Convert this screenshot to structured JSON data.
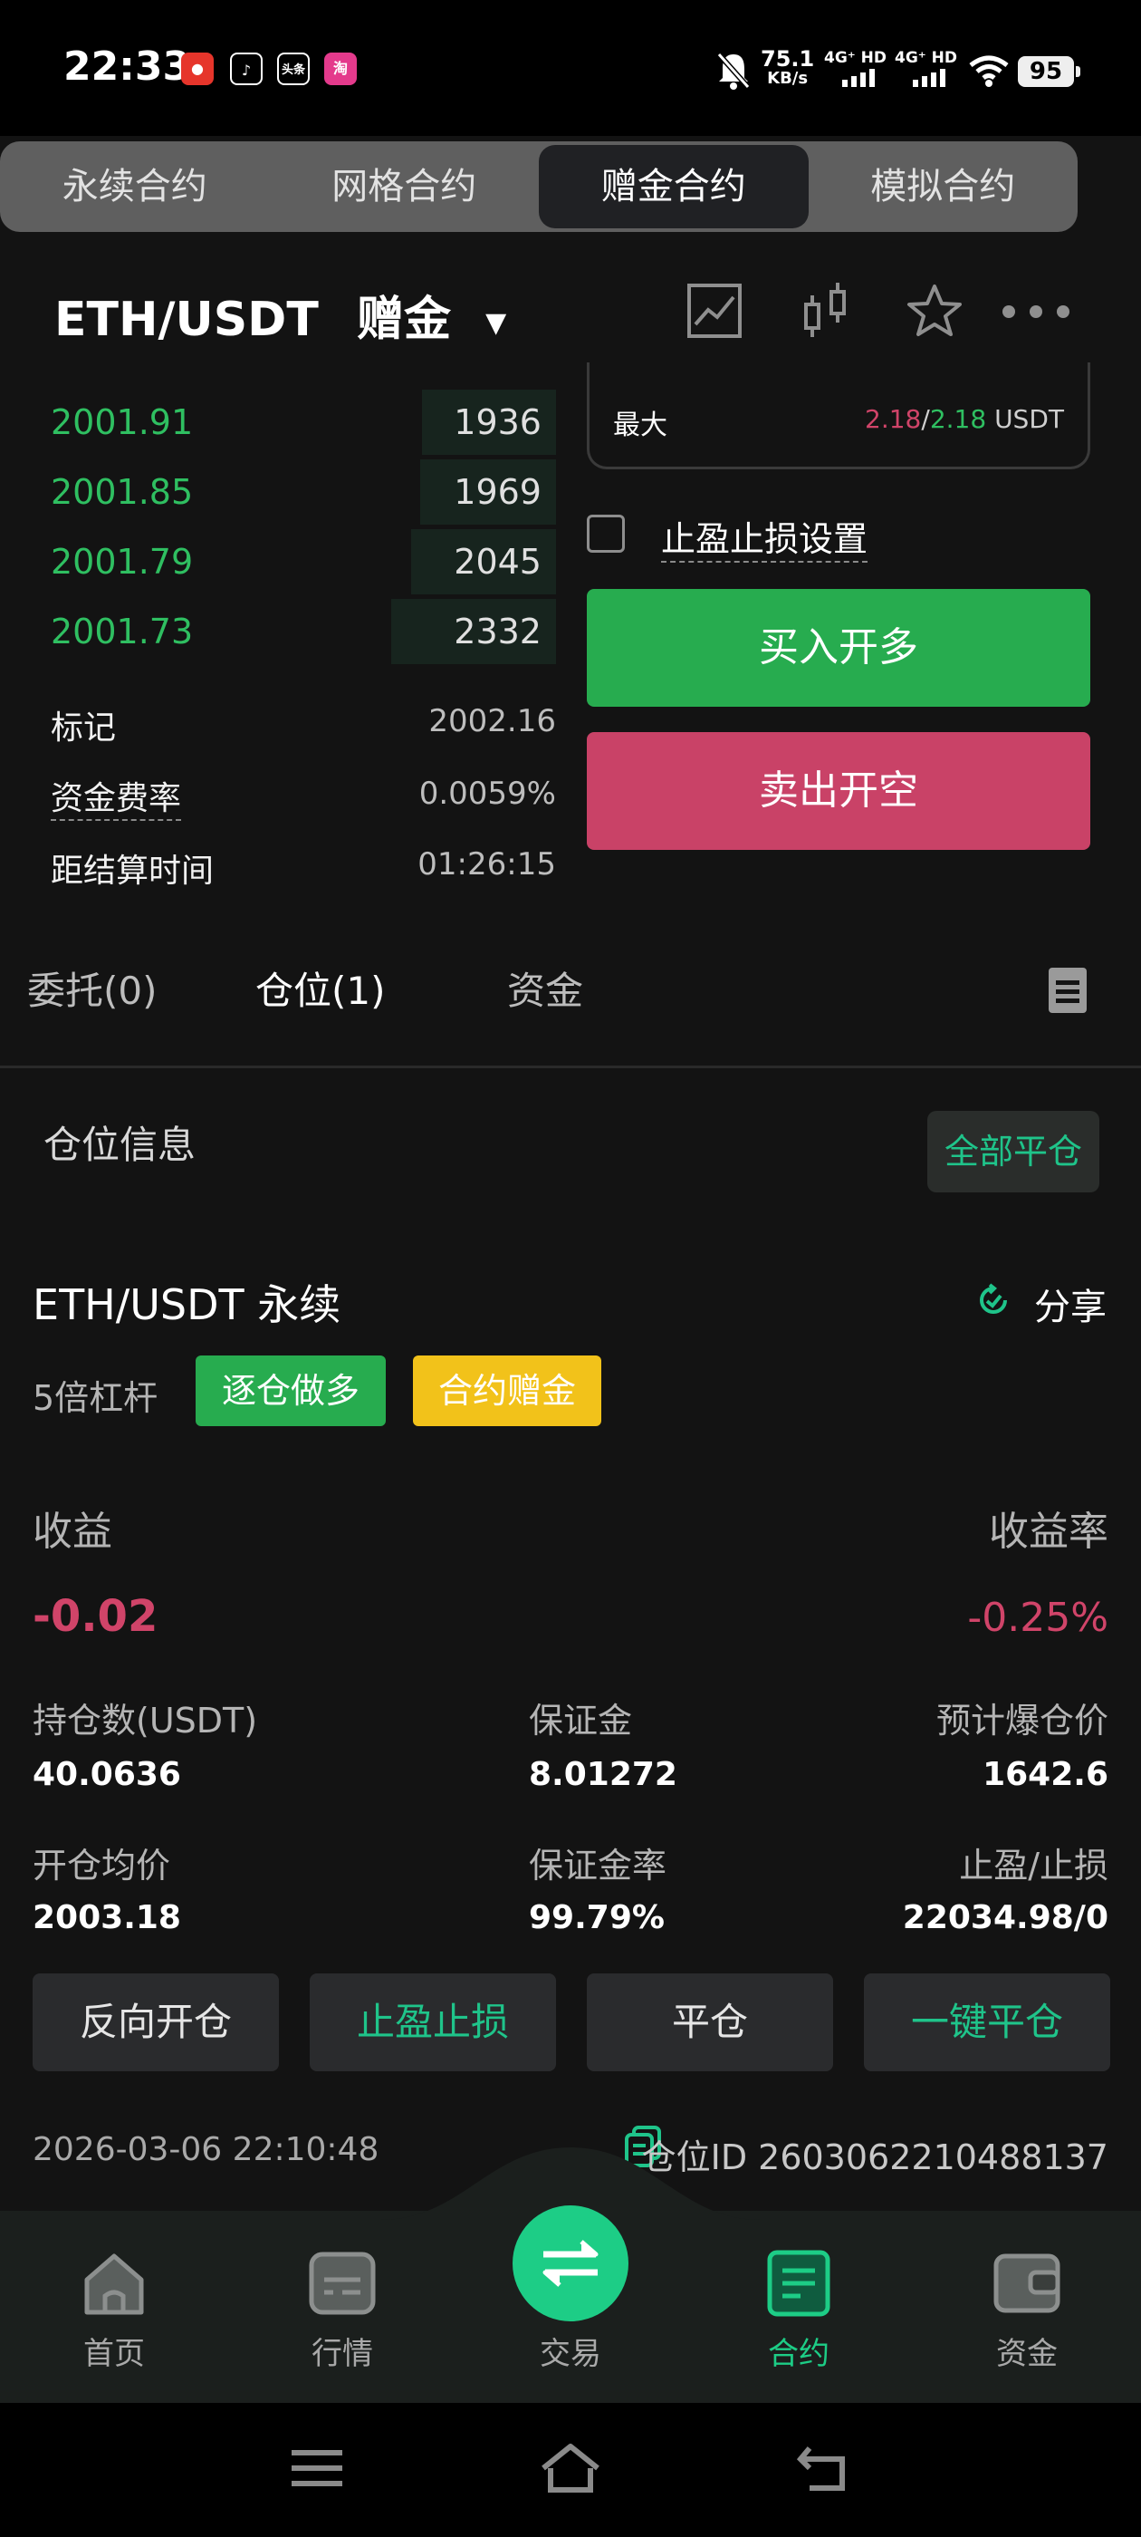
{
  "status_bar": {
    "time": "22:33",
    "app_icons": [
      "app-icon-1",
      "app-icon-2",
      "头条",
      "淘"
    ],
    "net_speed_value": "75.1",
    "net_speed_unit": "KB/s",
    "signal1_label": "4G⁺ HD",
    "signal2_label": "4G⁺ HD",
    "battery": "95"
  },
  "top_tabs": [
    {
      "label": "永续合约",
      "active": false
    },
    {
      "label": "网格合约",
      "active": false
    },
    {
      "label": "赠金合约",
      "active": true
    },
    {
      "label": "模拟合约",
      "active": false
    }
  ],
  "header": {
    "pair": "ETH/USDT",
    "mode": "赠金",
    "icons": [
      "chart-icon",
      "candlestick-icon",
      "star-icon",
      "more-icon"
    ]
  },
  "orderbook": {
    "bids": [
      {
        "price": "2001.91",
        "qty": "1936",
        "depth": 0.14
      },
      {
        "price": "2001.85",
        "qty": "1969",
        "depth": 0.14
      },
      {
        "price": "2001.79",
        "qty": "2045",
        "depth": 0.16
      },
      {
        "price": "2001.73",
        "qty": "2332",
        "depth": 0.18
      }
    ],
    "mark_label": "标记",
    "mark_value": "2002.16",
    "funding_label": "资金费率",
    "funding_value": "0.0059%",
    "settle_label": "距结算时间",
    "settle_value": "01:26:15"
  },
  "trade_panel": {
    "max_label": "最大",
    "max_sell": "2.18",
    "max_buy": "2.18",
    "max_unit": "USDT",
    "tpsl_label": "止盈止损设置",
    "buy_label": "买入开多",
    "sell_label": "卖出开空"
  },
  "order_tabs": [
    {
      "label": "委托(0)",
      "active": false
    },
    {
      "label": "仓位(1)",
      "active": true
    },
    {
      "label": "资金",
      "active": false
    }
  ],
  "position_header": {
    "title": "仓位信息",
    "close_all": "全部平仓"
  },
  "position": {
    "symbol": "ETH/USDT 永续",
    "share": "分享",
    "leverage": "5倍杠杆",
    "tag_long": "逐仓做多",
    "tag_bonus": "合约赠金",
    "pnl_label": "收益",
    "pnl_value": "-0.02",
    "roe_label": "收益率",
    "roe_value": "-0.25%",
    "size_label": "持仓数(USDT)",
    "size_value": "40.0636",
    "margin_label": "保证金",
    "margin_value": "8.01272",
    "liq_label": "预计爆仓价",
    "liq_value": "1642.6",
    "entry_label": "开仓均价",
    "entry_value": "2003.18",
    "margin_rate_label": "保证金率",
    "margin_rate_value": "99.79%",
    "tpsl_label": "止盈/止损",
    "tpsl_value": "22034.98/0",
    "btn_reverse": "反向开仓",
    "btn_tpsl": "止盈止损",
    "btn_close": "平仓",
    "btn_close_one": "一键平仓",
    "time": "2026-03-06 22:10:48",
    "id_label": "仓位ID 2603062210488137"
  },
  "bottom_nav": [
    {
      "label": "首页",
      "icon": "home-icon",
      "active": false
    },
    {
      "label": "行情",
      "icon": "market-icon",
      "active": false
    },
    {
      "label": "交易",
      "icon": "swap-icon",
      "active": false
    },
    {
      "label": "合约",
      "icon": "contract-icon",
      "active": true
    },
    {
      "label": "资金",
      "icon": "wallet-icon",
      "active": false
    }
  ],
  "colors": {
    "green": "#2fbf61",
    "red": "#d04469",
    "yellow": "#f2c21a",
    "teal": "#1fc48a"
  }
}
